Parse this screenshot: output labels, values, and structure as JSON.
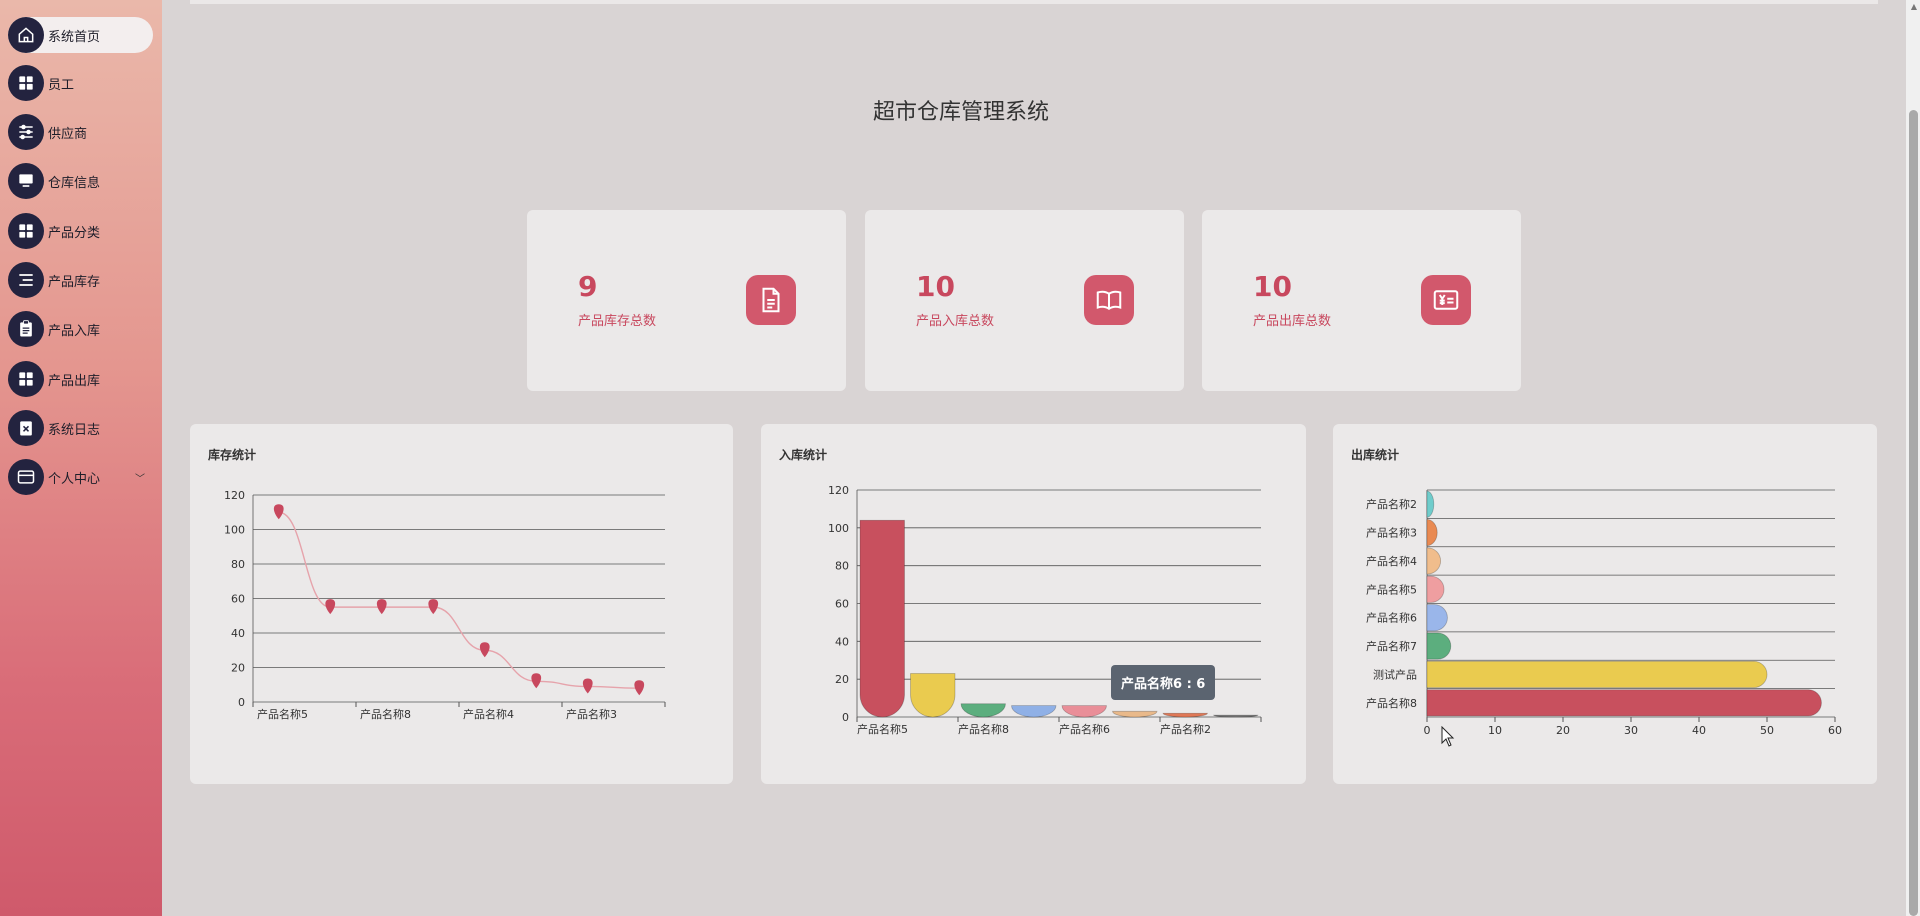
{
  "sidebar": {
    "items": [
      {
        "label": "系统首页",
        "icon": "home-icon"
      },
      {
        "label": "员工",
        "icon": "grid-icon"
      },
      {
        "label": "供应商",
        "icon": "sliders-icon"
      },
      {
        "label": "仓库信息",
        "icon": "monitor-icon"
      },
      {
        "label": "产品分类",
        "icon": "grid-icon"
      },
      {
        "label": "产品库存",
        "icon": "list-icon"
      },
      {
        "label": "产品入库",
        "icon": "clipboard-icon"
      },
      {
        "label": "产品出库",
        "icon": "grid-icon"
      },
      {
        "label": "系统日志",
        "icon": "clipboard-x-icon"
      },
      {
        "label": "个人中心",
        "icon": "card-icon"
      }
    ]
  },
  "header": {
    "title": "超市仓库管理系统"
  },
  "stats": [
    {
      "value": "9",
      "label": "产品库存总数",
      "icon": "document-icon"
    },
    {
      "value": "10",
      "label": "产品入库总数",
      "icon": "book-icon"
    },
    {
      "value": "10",
      "label": "产品出库总数",
      "icon": "yen-invoice-icon"
    }
  ],
  "colors": {
    "accent": "#c8485e",
    "sidebar_dark": "#23233f"
  },
  "chart_data": [
    {
      "type": "line",
      "title": "库存统计",
      "categories": [
        "产品名称5",
        "产品名称8",
        "产品名称4",
        "产品名称3"
      ],
      "values": [
        110,
        55,
        55,
        55,
        30,
        12,
        9,
        8
      ],
      "ylim": [
        0,
        120
      ],
      "yticks": [
        0,
        20,
        40,
        60,
        80,
        100,
        120
      ],
      "grid": true
    },
    {
      "type": "bar",
      "title": "入库统计",
      "categories": [
        "产品名称5",
        "产品名称8",
        "产品名称6",
        "产品名称2"
      ],
      "values": [
        104,
        23,
        7,
        6,
        6,
        3,
        2,
        1
      ],
      "colors": [
        "#c8505e",
        "#eacb4f",
        "#5cae7e",
        "#8fb0e6",
        "#e98e98",
        "#e9b98a",
        "#e07856",
        "#7a7a7a"
      ],
      "ylim": [
        0,
        120
      ],
      "yticks": [
        0,
        20,
        40,
        60,
        80,
        100,
        120
      ],
      "tooltip": "产品名称6 : 6",
      "grid": true
    },
    {
      "type": "bar",
      "orientation": "horizontal",
      "title": "出库统计",
      "categories": [
        "产品名称2",
        "产品名称3",
        "产品名称4",
        "产品名称5",
        "产品名称6",
        "产品名称7",
        "测试产品",
        "产品名称8"
      ],
      "values": [
        1,
        1.5,
        2,
        2.5,
        3,
        3.5,
        50,
        58
      ],
      "colors": [
        "#6fcccb",
        "#e98a52",
        "#f0bd8c",
        "#ef9ea0",
        "#9ab6ea",
        "#5cae7e",
        "#eacb4f",
        "#c8505e"
      ],
      "xlim": [
        0,
        60
      ],
      "xticks": [
        0,
        10,
        20,
        30,
        40,
        50,
        60
      ],
      "grid": true
    }
  ]
}
